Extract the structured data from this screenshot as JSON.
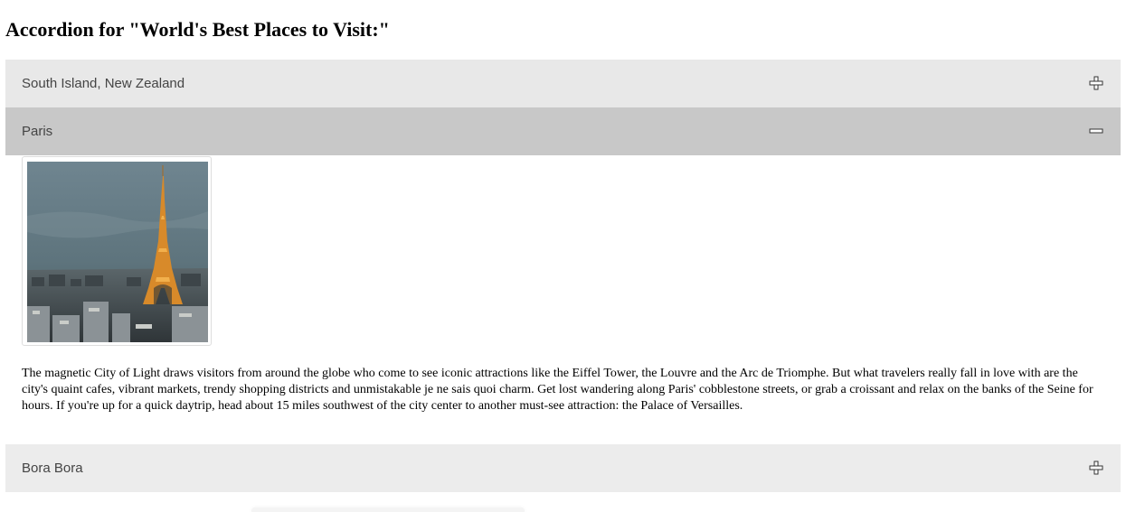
{
  "heading": "Accordion for \"World's Best Places to Visit:\"",
  "accordion": {
    "items": [
      {
        "label": "South Island, New Zealand",
        "state": "collapsed",
        "icon": "plus-icon"
      },
      {
        "label": "Paris",
        "state": "expanded",
        "icon": "minus-icon",
        "image_subject": "Eiffel Tower at dusk over Paris skyline",
        "text": "The magnetic City of Light draws visitors from around the globe who come to see iconic attractions like the Eiffel Tower, the Louvre and the Arc de Triomphe. But what travelers really fall in love with are the city's quaint cafes, vibrant markets, trendy shopping districts and unmistakable je ne sais quoi charm. Get lost wandering along Paris' cobblestone streets, or grab a croissant and relax on the banks of the Seine for hours. If you're up for a quick daytrip, head about 15 miles southwest of the city center to another must-see attraction: the Palace of Versailles."
      },
      {
        "label": "Bora Bora",
        "state": "collapsed",
        "icon": "plus-icon"
      }
    ]
  },
  "colors": {
    "header_collapsed": "#e8e8e8",
    "header_active": "#c8c8c8",
    "header_last": "#ececec",
    "header_text": "#444444"
  }
}
